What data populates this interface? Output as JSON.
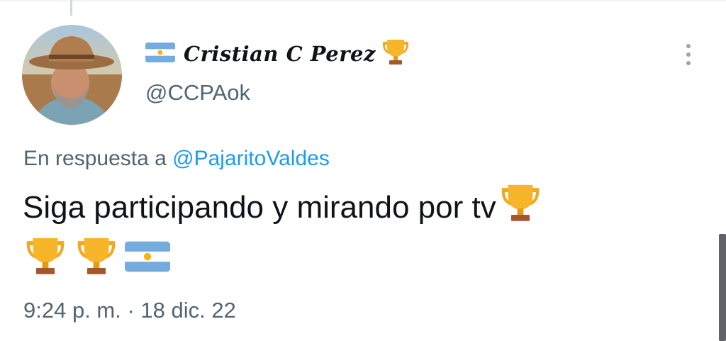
{
  "author": {
    "display_name": "Cristian C Perez",
    "handle": "@CCPAok",
    "name_prefix_icon": "argentina-flag-icon",
    "name_suffix_icon": "trophy-icon"
  },
  "reply": {
    "prefix": "En respuesta a",
    "mention": "@PajaritoValdes"
  },
  "tweet": {
    "text": "Siga participando y mirando por tv",
    "trailing_emojis": [
      "trophy-icon",
      "trophy-icon",
      "trophy-icon",
      "argentina-flag-icon"
    ]
  },
  "timestamp": "9:24 p. m. · 18 dic. 22",
  "colors": {
    "text_primary": "#0f1419",
    "text_secondary": "#536471",
    "link": "#1d9bf0",
    "flag_blue": "#74acdf",
    "sun": "#f6b40e",
    "trophy_gold": "#f4a820"
  }
}
